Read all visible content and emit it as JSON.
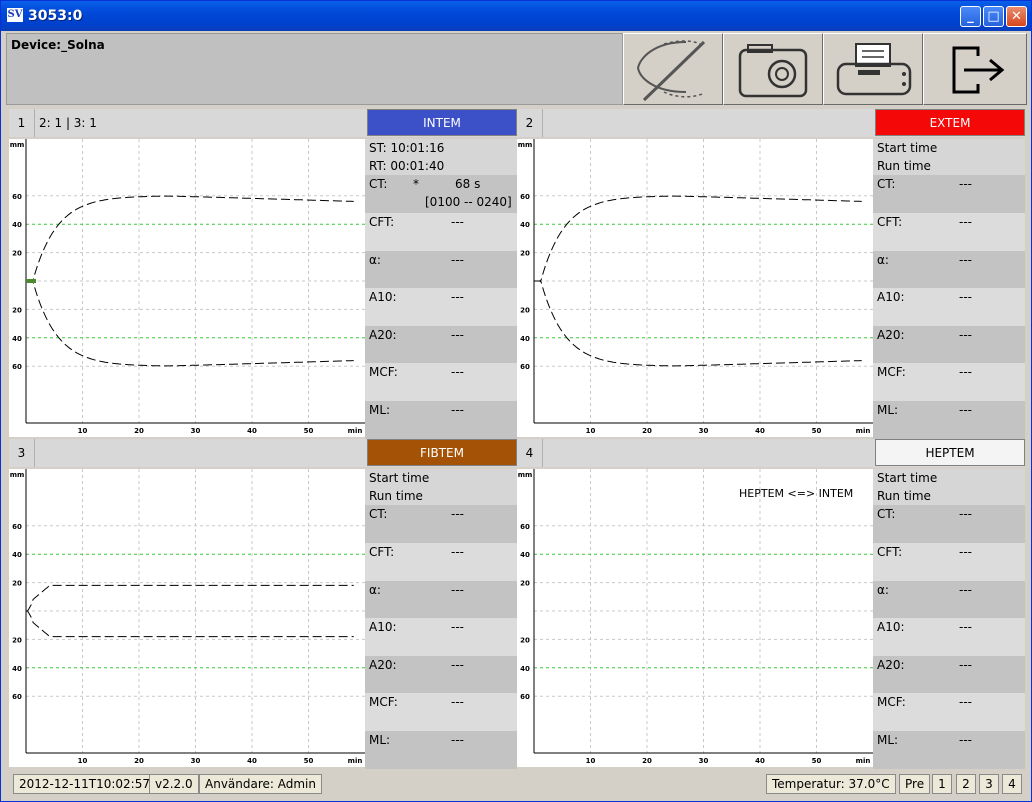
{
  "window": {
    "title": "3053:0",
    "app_icon": "SV",
    "minimize": "_",
    "maximize": "□",
    "close": "✕"
  },
  "header": {
    "device": "Device:_Solna"
  },
  "toolbar": [
    "curve-off-icon",
    "camera-icon",
    "printer-icon",
    "exit-icon"
  ],
  "panels": [
    {
      "num": "1",
      "extra": "2: 1  |  3: 1",
      "assay": "INTEM",
      "assay_color": "#3c50c8",
      "assay_text_color": "#ffffff",
      "st": "ST: 10:01:16",
      "rt": "RT: 00:01:40",
      "ct_label": "CT:",
      "ct_star": "*",
      "ct_value": "68 s",
      "ct_range": "[0100 -- 0240]",
      "rows": [
        {
          "k": "CFT:",
          "v": "---"
        },
        {
          "k": "α:",
          "v": "---"
        },
        {
          "k": "A10:",
          "v": "---"
        },
        {
          "k": "A20:",
          "v": "---"
        },
        {
          "k": "MCF:",
          "v": "---"
        },
        {
          "k": "ML:",
          "v": "---"
        }
      ]
    },
    {
      "num": "2",
      "extra": "",
      "assay": "EXTEM",
      "assay_color": "#f40808",
      "assay_text_color": "#ffffff",
      "st": "Start time",
      "rt": "Run time",
      "ct_label": "CT:",
      "ct_value": "---",
      "rows": [
        {
          "k": "CFT:",
          "v": "---"
        },
        {
          "k": "α:",
          "v": "---"
        },
        {
          "k": "A10:",
          "v": "---"
        },
        {
          "k": "A20:",
          "v": "---"
        },
        {
          "k": "MCF:",
          "v": "---"
        },
        {
          "k": "ML:",
          "v": "---"
        }
      ]
    },
    {
      "num": "3",
      "extra": "",
      "assay": "FIBTEM",
      "assay_color": "#a45206",
      "assay_text_color": "#ffffff",
      "st": "Start time",
      "rt": "Run time",
      "ct_label": "CT:",
      "ct_value": "---",
      "rows": [
        {
          "k": "CFT:",
          "v": "---"
        },
        {
          "k": "α:",
          "v": "---"
        },
        {
          "k": "A10:",
          "v": "---"
        },
        {
          "k": "A20:",
          "v": "---"
        },
        {
          "k": "MCF:",
          "v": "---"
        },
        {
          "k": "ML:",
          "v": "---"
        }
      ]
    },
    {
      "num": "4",
      "extra": "",
      "assay": "HEPTEM",
      "assay_color": "#f4f4f4",
      "assay_text_color": "#000000",
      "st": "Start time",
      "rt": "Run time",
      "ct_label": "CT:",
      "ct_value": "---",
      "note": "HEPTEM  <=>  INTEM",
      "rows": [
        {
          "k": "CFT:",
          "v": "---"
        },
        {
          "k": "α:",
          "v": "---"
        },
        {
          "k": "A10:",
          "v": "---"
        },
        {
          "k": "A20:",
          "v": "---"
        },
        {
          "k": "MCF:",
          "v": "---"
        },
        {
          "k": "ML:",
          "v": "---"
        }
      ]
    }
  ],
  "axis": {
    "y_unit": "mm",
    "x_unit": "min",
    "x_ticks": [
      "10",
      "20",
      "30",
      "40",
      "50"
    ],
    "y_upper": [
      "60",
      "40",
      "20"
    ],
    "y_lower": [
      "20",
      "40",
      "60"
    ]
  },
  "curves": {
    "1": 60,
    "2": 60,
    "3": 18,
    "4": 0
  },
  "status": {
    "datetime": "2012-12-11T10:02:57",
    "version": "v2.2.0",
    "user": "Användare: Admin",
    "temp": "Temperatur: 37.0°C",
    "pre": "Pre",
    "pages": [
      "1",
      "2",
      "3",
      "4"
    ]
  }
}
